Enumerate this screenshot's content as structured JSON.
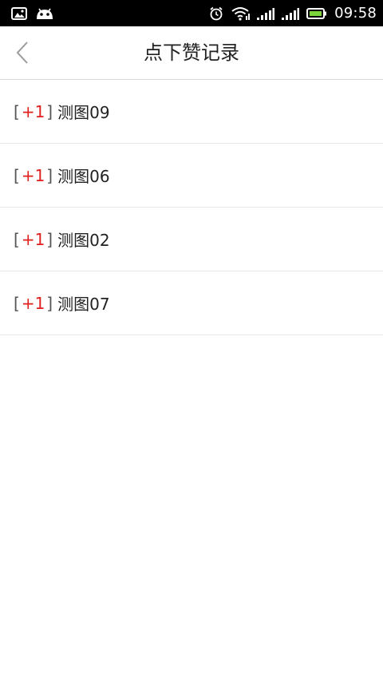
{
  "status_bar": {
    "time": "09:58",
    "icons": [
      "image-icon",
      "android-icon",
      "alarm-icon",
      "wifi-icon",
      "signal-icon",
      "signal-icon",
      "battery-icon"
    ]
  },
  "header": {
    "title": "点下赞记录",
    "back_icon": "chevron-left-icon"
  },
  "records": [
    {
      "badge_open": "[",
      "badge": "+1",
      "badge_close": "]",
      "name": "测图09"
    },
    {
      "badge_open": "[",
      "badge": "+1",
      "badge_close": "]",
      "name": "测图06"
    },
    {
      "badge_open": "[",
      "badge": "+1",
      "badge_close": "]",
      "name": "测图02"
    },
    {
      "badge_open": "[",
      "badge": "+1",
      "badge_close": "]",
      "name": "测图07"
    }
  ],
  "colors": {
    "badge_accent": "#e0201e",
    "status_bar_bg": "#000000",
    "divider": "#e6e6e6"
  }
}
